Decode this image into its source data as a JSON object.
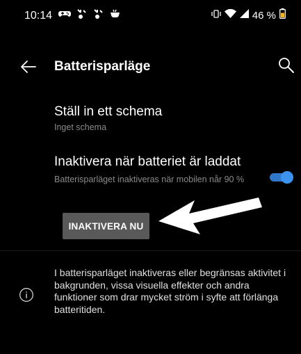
{
  "status_bar": {
    "time": "10:14",
    "battery_percent": "46 %",
    "notification_icons": [
      "game-controller-icon",
      "rewards-icon",
      "rewards-icon",
      "cup-icon"
    ],
    "status_icons": [
      "vibrate-icon",
      "wifi-icon",
      "signal-icon",
      "battery-icon"
    ]
  },
  "header": {
    "title": "Batterisparläge",
    "back_icon": "arrow-left-icon",
    "search_icon": "search-icon"
  },
  "settings": {
    "schedule": {
      "title": "Ställ in ett schema",
      "subtitle": "Inget schema"
    },
    "disable_when_charged": {
      "title": "Inaktivera när batteriet är laddat",
      "subtitle": "Batterisparläget inaktiveras när mobilen når 90 %",
      "enabled": true
    },
    "disable_now_label": "INAKTIVERA NU"
  },
  "info": {
    "icon": "info-icon",
    "text": "I batterisparläget inaktiveras eller begränsas aktivitet i bakgrunden, vissa visuella effekter och andra funktioner som drar mycket ström i syfte att förlänga batteritiden."
  },
  "colors": {
    "background": "#000000",
    "accent": "#3c93ef",
    "secondary_text": "#8a8a8a",
    "button_background": "#595959"
  }
}
